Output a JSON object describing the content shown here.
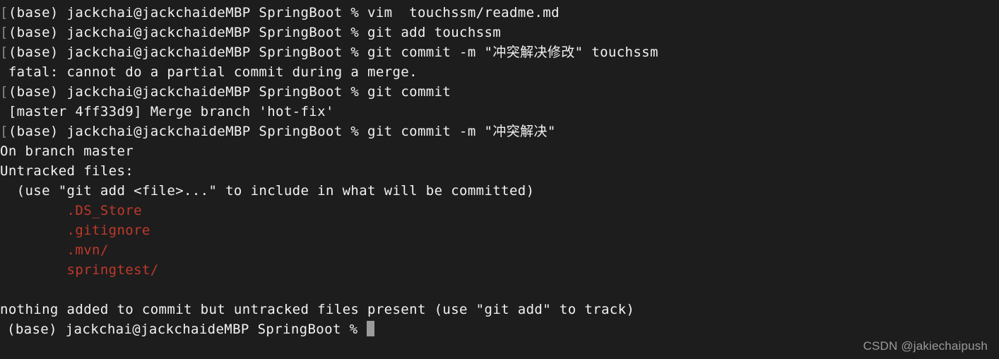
{
  "terminal": {
    "background_color": "#1d1d1d",
    "foreground_color": "#f2f2f2",
    "untracked_color": "#c0392b",
    "cursor_color": "#9b9b9b",
    "prompt_prefix": "(base) jackchai@jackchaideMBP SpringBoot % ",
    "wrap_bracket": "[",
    "lines": [
      {
        "type": "prompt",
        "bracket": "[",
        "prompt": "(base) jackchai@jackchaideMBP SpringBoot % ",
        "command": "vim  touchssm/readme.md"
      },
      {
        "type": "prompt",
        "bracket": "[",
        "prompt": "(base) jackchai@jackchaideMBP SpringBoot % ",
        "command": "git add touchssm"
      },
      {
        "type": "prompt",
        "bracket": "[",
        "prompt": "(base) jackchai@jackchaideMBP SpringBoot % ",
        "command": "git commit -m \"冲突解决修改\" touchssm"
      },
      {
        "type": "output",
        "text": " fatal: cannot do a partial commit during a merge."
      },
      {
        "type": "prompt",
        "bracket": "[",
        "prompt": "(base) jackchai@jackchaideMBP SpringBoot % ",
        "command": "git commit"
      },
      {
        "type": "output",
        "text": " [master 4ff33d9] Merge branch 'hot-fix'"
      },
      {
        "type": "prompt",
        "bracket": "[",
        "prompt": "(base) jackchai@jackchaideMBP SpringBoot % ",
        "command": "git commit -m \"冲突解决\""
      },
      {
        "type": "output",
        "text": "On branch master"
      },
      {
        "type": "output",
        "text": "Untracked files:"
      },
      {
        "type": "output",
        "text": "  (use \"git add <file>...\" to include in what will be committed)"
      },
      {
        "type": "untracked",
        "text": "        .DS_Store"
      },
      {
        "type": "untracked",
        "text": "        .gitignore"
      },
      {
        "type": "untracked",
        "text": "        .mvn/"
      },
      {
        "type": "untracked",
        "text": "        springtest/"
      },
      {
        "type": "blank",
        "text": ""
      },
      {
        "type": "output",
        "text": "nothing added to commit but untracked files present (use \"git add\" to track)"
      },
      {
        "type": "final-prompt",
        "prompt": "(base) jackchai@jackchaideMBP SpringBoot % ",
        "command": ""
      }
    ]
  },
  "watermark": {
    "text": "CSDN @jakiechaipush"
  }
}
